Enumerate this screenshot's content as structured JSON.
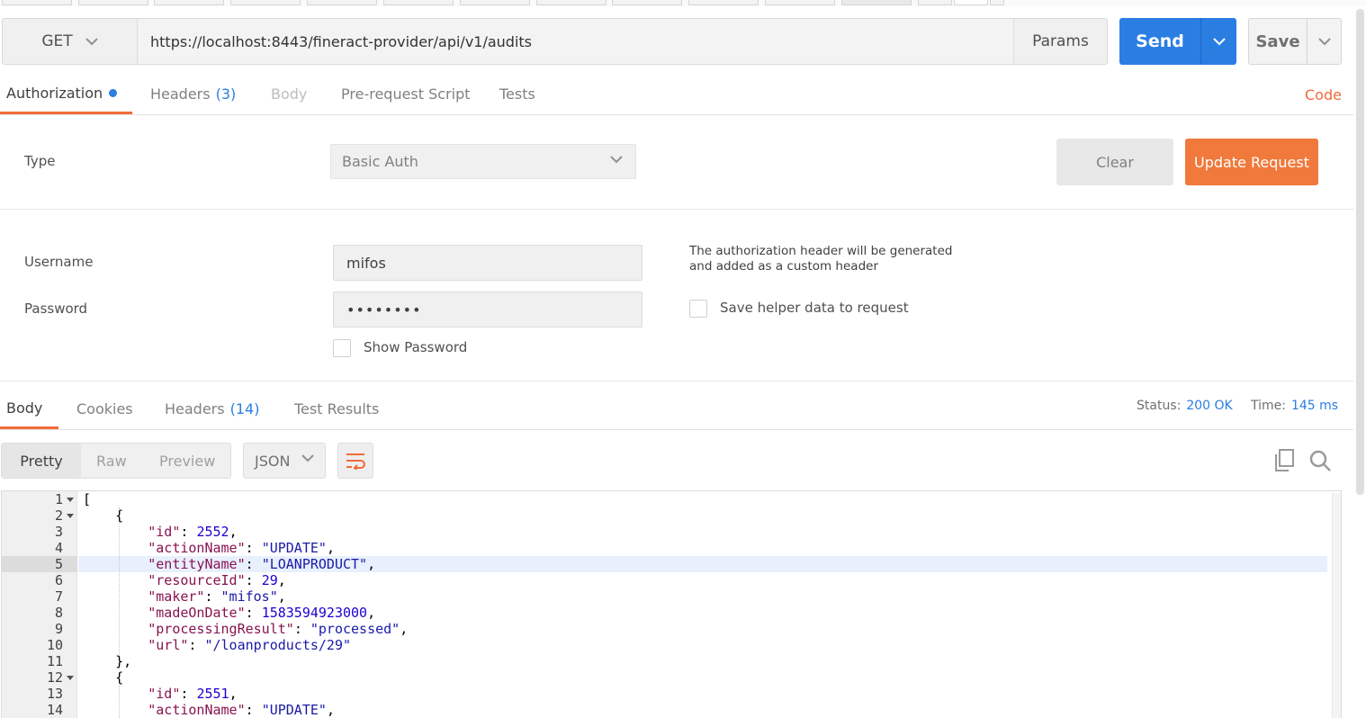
{
  "request": {
    "method": "GET",
    "url": "https://localhost:8443/fineract-provider/api/v1/audits",
    "params_label": "Params",
    "send_label": "Send",
    "save_label": "Save"
  },
  "request_tabs": [
    {
      "label": "Authorization",
      "count": ""
    },
    {
      "label": "Headers",
      "count": "(3)"
    },
    {
      "label": "Body",
      "count": ""
    },
    {
      "label": "Pre-request Script",
      "count": ""
    },
    {
      "label": "Tests",
      "count": ""
    }
  ],
  "code_link": "Code",
  "auth": {
    "type_label": "Type",
    "type_value": "Basic Auth",
    "clear_label": "Clear",
    "update_label": "Update Request",
    "username_label": "Username",
    "username_value": "mifos",
    "password_label": "Password",
    "password_value": "••••••••",
    "show_password_label": "Show Password",
    "note": "The authorization header will be generated and added as a custom header",
    "save_helper_label": "Save helper data to request"
  },
  "response_tabs": [
    {
      "label": "Body",
      "count": ""
    },
    {
      "label": "Cookies",
      "count": ""
    },
    {
      "label": "Headers",
      "count": "(14)"
    },
    {
      "label": "Test Results",
      "count": ""
    }
  ],
  "status": {
    "label": "Status:",
    "value": "200 OK",
    "time_label": "Time:",
    "time_value": "145 ms"
  },
  "view_modes": [
    "Pretty",
    "Raw",
    "Preview"
  ],
  "format": "JSON",
  "icons": {
    "copy": "copy-icon",
    "search": "search-icon",
    "wrap": "wrap-lines-icon"
  },
  "colors": {
    "accent": "#f26b3a",
    "primary": "#2a7ee2"
  },
  "code_lines": [
    {
      "n": "1",
      "text": "["
    },
    {
      "n": "2",
      "text": "    {"
    },
    {
      "n": "3",
      "key": "\"id\"",
      "val": "2552",
      "type": "n"
    },
    {
      "n": "4",
      "key": "\"actionName\"",
      "val": "\"UPDATE\"",
      "type": "s"
    },
    {
      "n": "5",
      "key": "\"entityName\"",
      "val": "\"LOANPRODUCT\"",
      "type": "s"
    },
    {
      "n": "6",
      "key": "\"resourceId\"",
      "val": "29",
      "type": "n"
    },
    {
      "n": "7",
      "key": "\"maker\"",
      "val": "\"mifos\"",
      "type": "s"
    },
    {
      "n": "8",
      "key": "\"madeOnDate\"",
      "val": "1583594923000",
      "type": "n"
    },
    {
      "n": "9",
      "key": "\"processingResult\"",
      "val": "\"processed\"",
      "type": "s"
    },
    {
      "n": "10",
      "key": "\"url\"",
      "val": "\"/loanproducts/29\"",
      "type": "s",
      "last": true
    },
    {
      "n": "11",
      "text": "    },"
    },
    {
      "n": "12",
      "text": "    {"
    },
    {
      "n": "13",
      "key": "\"id\"",
      "val": "2551",
      "type": "n"
    },
    {
      "n": "14",
      "key": "\"actionName\"",
      "val": "\"UPDATE\"",
      "type": "s"
    }
  ]
}
